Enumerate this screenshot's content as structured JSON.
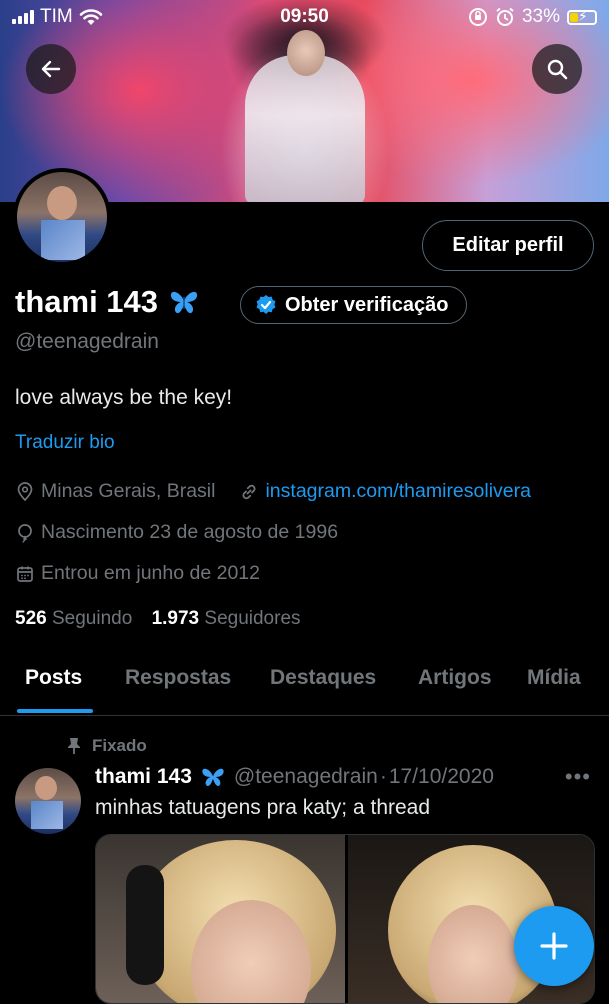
{
  "status_bar": {
    "carrier": "TIM",
    "time": "09:50",
    "battery": "33%"
  },
  "profile": {
    "display_name": "thami 143",
    "name_emoji": "butterfly-icon",
    "handle": "@teenagedrain",
    "edit_button": "Editar perfil",
    "verify_button": "Obter verificação",
    "bio": "love always be the key!",
    "translate_bio": "Traduzir bio",
    "location": "Minas Gerais, Brasil",
    "website": "instagram.com/thamiresolivera",
    "birthday": "Nascimento 23 de agosto de 1996",
    "joined": "Entrou em junho de 2012",
    "following_count": "526",
    "following_label": "Seguindo",
    "followers_count": "1.973",
    "followers_label": "Seguidores"
  },
  "tabs": [
    {
      "label": "Posts",
      "active": true
    },
    {
      "label": "Respostas"
    },
    {
      "label": "Destaques"
    },
    {
      "label": "Artigos"
    },
    {
      "label": "Mídia"
    }
  ],
  "pinned_post": {
    "pinned_label": "Fixado",
    "author_name": "thami 143",
    "author_handle": "@teenagedrain",
    "separator": "·",
    "date": "17/10/2020",
    "text": "minhas tatuagens pra katy; a thread"
  },
  "colors": {
    "accent": "#1d9bf0",
    "background": "#000000",
    "muted_text": "#71767b",
    "border": "#536471"
  }
}
